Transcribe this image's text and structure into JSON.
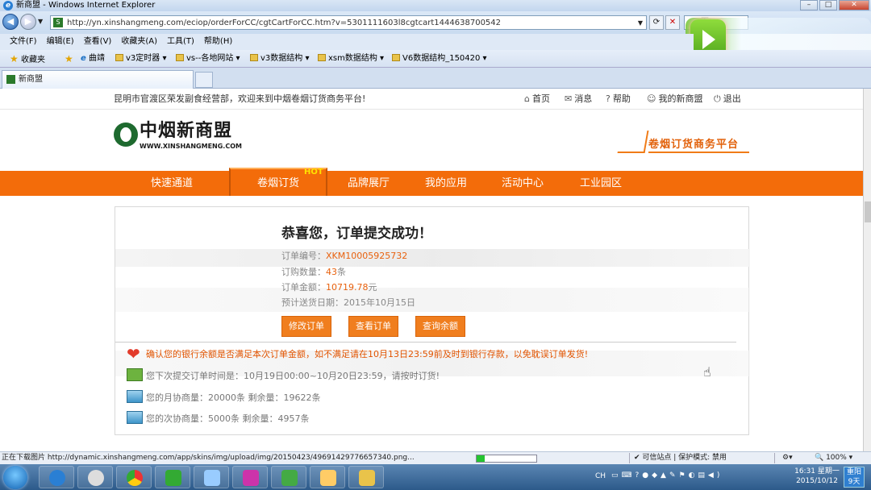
{
  "window": {
    "title": "新商盟 - Windows Internet Explorer"
  },
  "address": {
    "url": "http://yn.xinshangmeng.com/eciop/orderForCC/cgtCartForCC.htm?v=5301111603l8cgtcart1444638700542",
    "search_hint": "百"
  },
  "menu": [
    "文件(F)",
    "编辑(E)",
    "查看(V)",
    "收藏夹(A)",
    "工具(T)",
    "帮助(H)"
  ],
  "favorites": {
    "label": "收藏夹",
    "items": [
      "曲靖",
      "v3定时器 ▾",
      "vs--各地网站 ▾",
      "v3数据结构 ▾",
      "xsm数据结构 ▾",
      "V6数据结构_150420 ▾"
    ]
  },
  "tab": {
    "title": "新商盟"
  },
  "site": {
    "welcome": "昆明市官渡区荣发副食经营部，欢迎来到中烟卷烟订货商务平台!",
    "links": {
      "home": "首页",
      "msg": "消息",
      "help": "帮助",
      "mine": "我的新商盟",
      "logout": "退出"
    },
    "logo_cn": "中烟新商盟",
    "logo_en": "WWW.XINSHANGMENG.COM",
    "platform": "卷烟订货商务平台",
    "nav": [
      "快速通道",
      "卷烟订货",
      "品牌展厅",
      "我的应用",
      "活动中心",
      "工业园区"
    ],
    "hot": "HOT"
  },
  "order": {
    "title": "恭喜您，订单提交成功！",
    "no_label": "订单编号：",
    "no": "XKM10005925732",
    "qty_label": "订购数量：",
    "qty": "43",
    "qty_unit": "条",
    "amount_label": "订单金额：",
    "amount": "10719.78",
    "amount_unit": "元",
    "date_label": "预计送货日期：",
    "date": "2015年10月15日",
    "buttons": {
      "modify": "修改订单",
      "view": "查看订单",
      "balance": "查询余额"
    }
  },
  "notes": {
    "warn": "确认您的银行余额是否满足本次订单金额，如不满足请在10月13日23:59前及时到银行存款，以免耽误订单发货!",
    "next": "您下次提交订单时间是：10月19日00:00~10月20日23:59，请按时订货!",
    "monthly": "您的月协商量：20000条 剩余量：19622条",
    "once": "您的次协商量：5000条 剩余量：4957条"
  },
  "statusbar": {
    "msg": "正在下载图片 http://dynamic.xinshangmeng.com/app/skins/img/upload/img/20150423/49691429776657340.png...",
    "progress": 0.13,
    "zone": "✔ 可信站点 | 保护模式: 禁用",
    "zoom": "🔍 100% ▾"
  },
  "taskbar": {
    "clock_time": "16:31 星期一",
    "clock_date": "2015/10/12",
    "day": "重阳 9天",
    "lang": "CH"
  }
}
